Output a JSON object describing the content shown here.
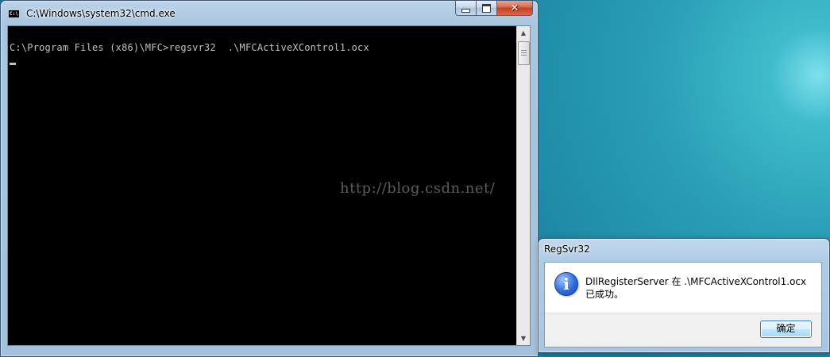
{
  "cmd_window": {
    "title": "C:\\Windows\\system32\\cmd.exe",
    "icon_text": "C:\\",
    "console_line": "C:\\Program Files (x86)\\MFC>regsvr32  .\\MFCActiveXControl1.ocx",
    "watermark": "http://blog.csdn.net/"
  },
  "dialog": {
    "title": "RegSvr32",
    "message": "DllRegisterServer 在 .\\MFCActiveXControl1.ocx 已成功。",
    "ok_label": "确定"
  },
  "icons": {
    "app": "cmd-icon",
    "info": "information-icon",
    "minimize": "minimize-icon",
    "maximize": "maximize-icon",
    "close": "close-icon"
  }
}
